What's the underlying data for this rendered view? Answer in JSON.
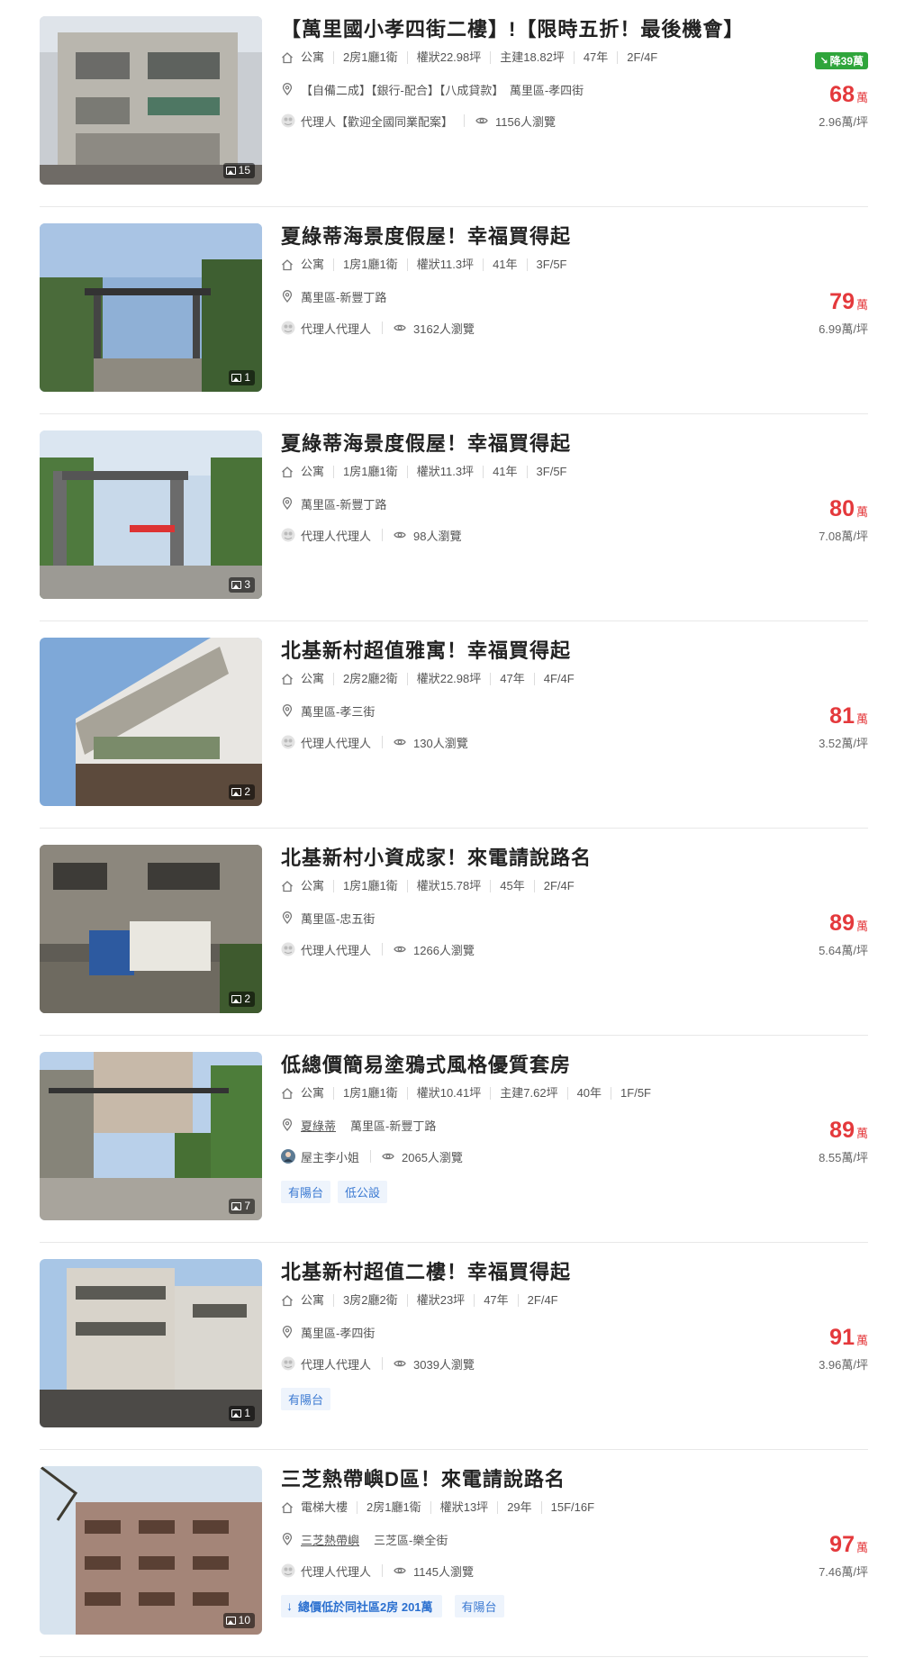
{
  "listings": [
    {
      "title": "【萬里國小孝四街二樓】!【限時五折！最後機會】",
      "type": "公寓",
      "specs": [
        "2房1廳1衛",
        "權狀22.98坪",
        "主建18.82坪",
        "47年",
        "2F/4F"
      ],
      "community": "",
      "location": "【自備二成】【銀行-配合】【八成貸款】　萬里區-孝四街",
      "agent": "代理人【歡迎全國同業配案】",
      "views": "1156人瀏覽",
      "price": "68",
      "price_unit": "萬",
      "price_per_ping": "2.96萬/坪",
      "price_drop": "降39萬",
      "photo_count": "15",
      "tags": [],
      "promo": ""
    },
    {
      "title": "夏綠蒂海景度假屋！幸福買得起",
      "type": "公寓",
      "specs": [
        "1房1廳1衛",
        "權狀11.3坪",
        "41年",
        "3F/5F"
      ],
      "community": "",
      "location": "萬里區-新豐丁路",
      "agent": "代理人代理人",
      "views": "3162人瀏覽",
      "price": "79",
      "price_unit": "萬",
      "price_per_ping": "6.99萬/坪",
      "price_drop": "",
      "photo_count": "1",
      "tags": [],
      "promo": ""
    },
    {
      "title": "夏綠蒂海景度假屋！幸福買得起",
      "type": "公寓",
      "specs": [
        "1房1廳1衛",
        "權狀11.3坪",
        "41年",
        "3F/5F"
      ],
      "community": "",
      "location": "萬里區-新豐丁路",
      "agent": "代理人代理人",
      "views": "98人瀏覽",
      "price": "80",
      "price_unit": "萬",
      "price_per_ping": "7.08萬/坪",
      "price_drop": "",
      "photo_count": "3",
      "tags": [],
      "promo": ""
    },
    {
      "title": "北基新村超值雅寓！幸福買得起",
      "type": "公寓",
      "specs": [
        "2房2廳2衛",
        "權狀22.98坪",
        "47年",
        "4F/4F"
      ],
      "community": "",
      "location": "萬里區-孝三街",
      "agent": "代理人代理人",
      "views": "130人瀏覽",
      "price": "81",
      "price_unit": "萬",
      "price_per_ping": "3.52萬/坪",
      "price_drop": "",
      "photo_count": "2",
      "tags": [],
      "promo": ""
    },
    {
      "title": "北基新村小資成家！來電請說路名",
      "type": "公寓",
      "specs": [
        "1房1廳1衛",
        "權狀15.78坪",
        "45年",
        "2F/4F"
      ],
      "community": "",
      "location": "萬里區-忠五街",
      "agent": "代理人代理人",
      "views": "1266人瀏覽",
      "price": "89",
      "price_unit": "萬",
      "price_per_ping": "5.64萬/坪",
      "price_drop": "",
      "photo_count": "2",
      "tags": [],
      "promo": ""
    },
    {
      "title": "低總價簡易塗鴉式風格優質套房",
      "type": "公寓",
      "specs": [
        "1房1廳1衛",
        "權狀10.41坪",
        "主建7.62坪",
        "40年",
        "1F/5F"
      ],
      "community": "夏綠蒂",
      "location": "萬里區-新豐丁路",
      "agent": "屋主李小姐",
      "views": "2065人瀏覽",
      "price": "89",
      "price_unit": "萬",
      "price_per_ping": "8.55萬/坪",
      "price_drop": "",
      "photo_count": "7",
      "tags": [
        "有陽台",
        "低公設"
      ],
      "promo": ""
    },
    {
      "title": "北基新村超值二樓！幸福買得起",
      "type": "公寓",
      "specs": [
        "3房2廳2衛",
        "權狀23坪",
        "47年",
        "2F/4F"
      ],
      "community": "",
      "location": "萬里區-孝四街",
      "agent": "代理人代理人",
      "views": "3039人瀏覽",
      "price": "91",
      "price_unit": "萬",
      "price_per_ping": "3.96萬/坪",
      "price_drop": "",
      "photo_count": "1",
      "tags": [
        "有陽台"
      ],
      "promo": ""
    },
    {
      "title": "三芝熱帶嶼D區！來電請說路名",
      "type": "電梯大樓",
      "specs": [
        "2房1廳1衛",
        "權狀13坪",
        "29年",
        "15F/16F"
      ],
      "community": "三芝熱帶嶼",
      "location": "三芝區-樂全街",
      "agent": "代理人代理人",
      "views": "1145人瀏覽",
      "price": "97",
      "price_unit": "萬",
      "price_per_ping": "7.46萬/坪",
      "price_drop": "",
      "photo_count": "10",
      "tags": [
        "有陽台"
      ],
      "promo": "總價低於同社區2房 201萬"
    }
  ],
  "colors": {
    "price": "#e4393c",
    "tag": "#3c7ad2",
    "drop_badge": "#2fa53b"
  },
  "icons": {
    "type": "house-icon",
    "location": "map-pin-icon",
    "agent": "agent-avatar-icon",
    "views": "eye-icon",
    "photos": "photo-icon",
    "promo": "arrow-down-icon"
  }
}
